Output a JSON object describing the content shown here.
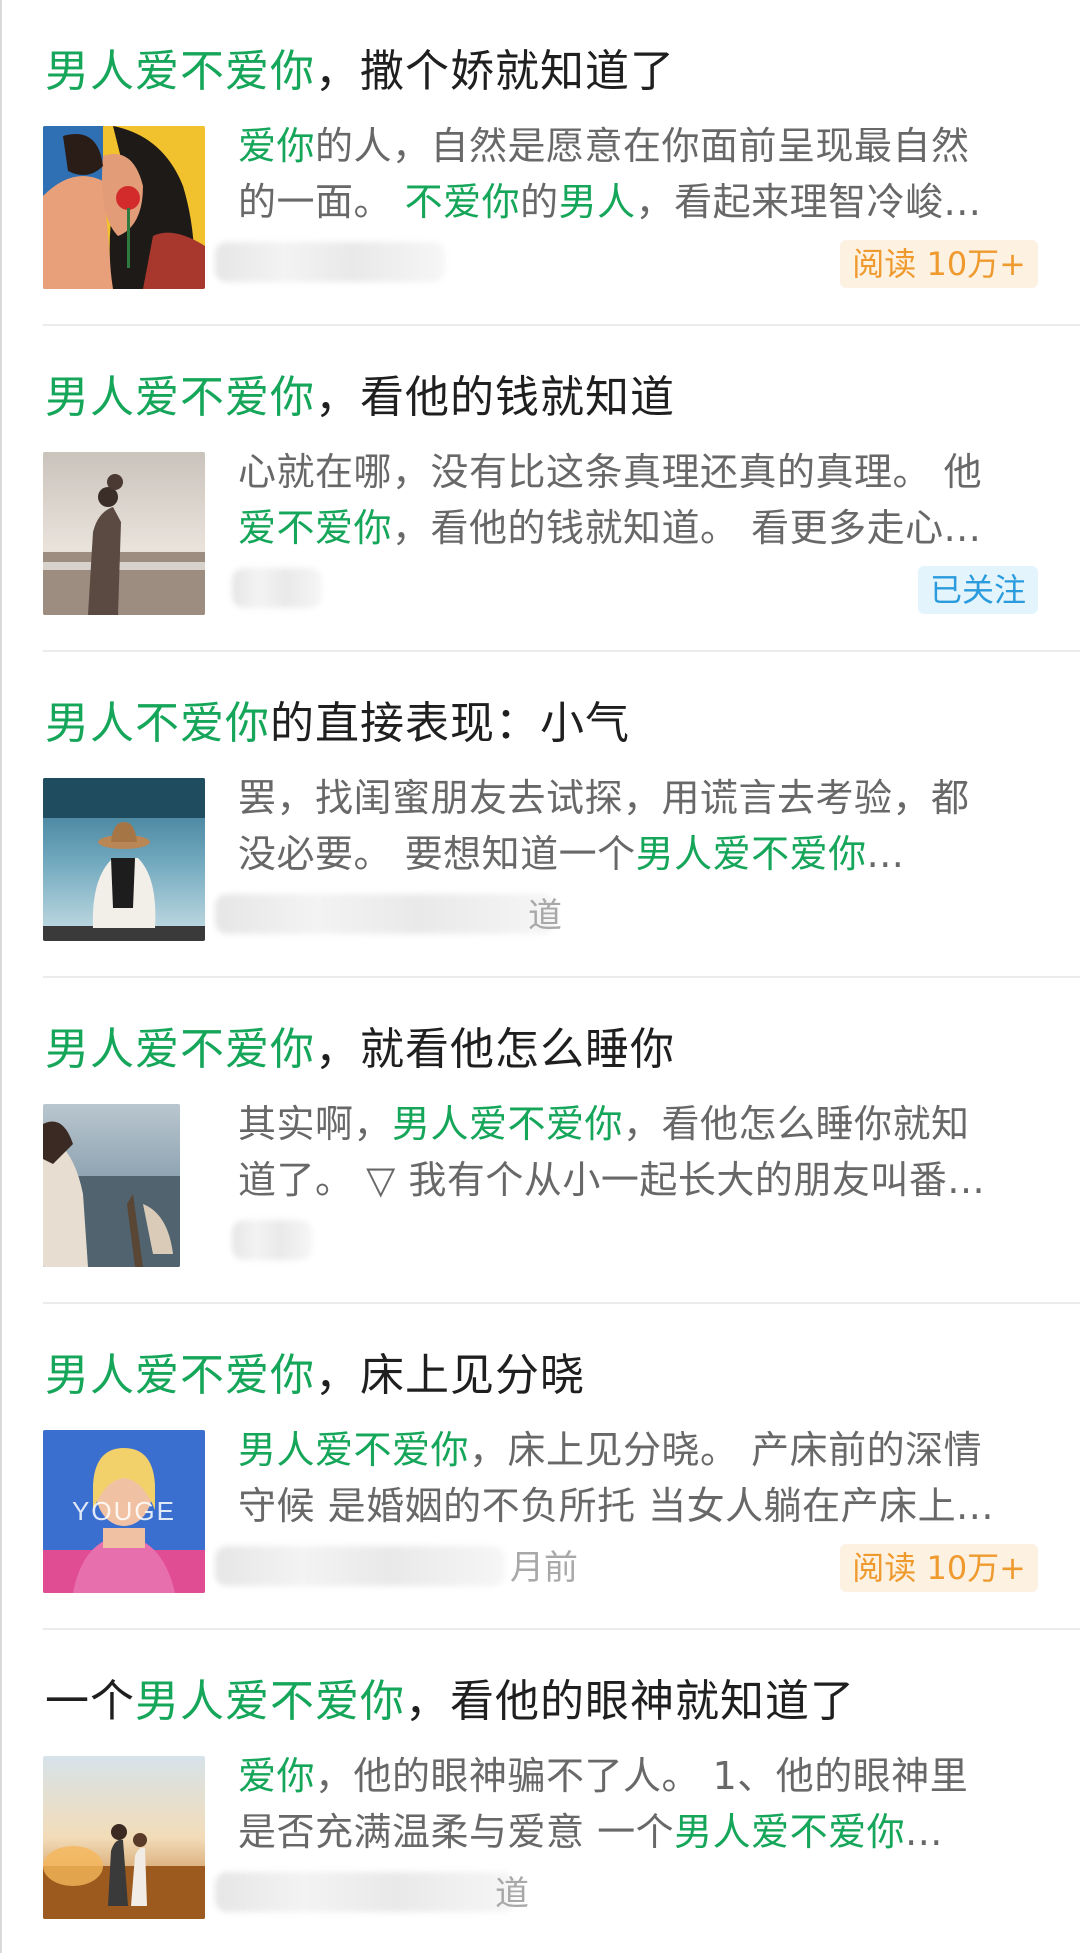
{
  "colors": {
    "highlight": "#15a65a",
    "snippet": "#686868",
    "read_badge": "#ef9a2f",
    "follow_badge": "#2a9bdc"
  },
  "articles": [
    {
      "title": [
        {
          "t": "男人爱不爱你",
          "h": true
        },
        {
          "t": "，撒个娇就知道了",
          "h": false
        }
      ],
      "snippet_lines": [
        [
          {
            "t": "爱你",
            "h": true
          },
          {
            "t": "的人，自然是愿意在你面前呈现最自然",
            "h": false
          }
        ],
        [
          {
            "t": "的一面。 ",
            "h": false
          },
          {
            "t": "不爱你",
            "h": true
          },
          {
            "t": "的",
            "h": false
          },
          {
            "t": "男人",
            "h": true
          },
          {
            "t": "，看起来理智冷峻...",
            "h": false
          }
        ]
      ],
      "thumbnail_icon": "couple-kiss-illustration",
      "badge": "阅读 10万+"
    },
    {
      "title": [
        {
          "t": "男人爱不爱你",
          "h": true
        },
        {
          "t": "，看他的钱就知道",
          "h": false
        }
      ],
      "snippet_lines": [
        [
          {
            "t": "心就在哪，没有比这条真理还真的真理。 他",
            "h": false
          }
        ],
        [
          {
            "t": "爱不爱你",
            "h": true
          },
          {
            "t": "，看他的钱就知道。 看更多走心...",
            "h": false
          }
        ]
      ],
      "thumbnail_icon": "beach-couple-photo",
      "badge": "已关注"
    },
    {
      "title": [
        {
          "t": "男人不爱你",
          "h": true
        },
        {
          "t": "的直接表现：小气",
          "h": false
        }
      ],
      "snippet_lines": [
        [
          {
            "t": "罢，找闺蜜朋友去试探，用谎言去考验，都",
            "h": false
          }
        ],
        [
          {
            "t": "没必要。 要想知道一个",
            "h": false
          },
          {
            "t": "男人爱不爱你",
            "h": true
          },
          {
            "t": "...",
            "h": false
          }
        ]
      ],
      "thumbnail_icon": "woman-hat-lake-photo",
      "meta_visible": "道"
    },
    {
      "title": [
        {
          "t": "男人爱不爱你",
          "h": true
        },
        {
          "t": "，就看他怎么睡你",
          "h": false
        }
      ],
      "snippet_lines": [
        [
          {
            "t": "其实啊，",
            "h": false
          },
          {
            "t": "男人爱不爱你",
            "h": true
          },
          {
            "t": "，看他怎么睡你就知",
            "h": false
          }
        ],
        [
          {
            "t": "道了。 ▽ 我有个从小一起长大的朋友叫番...",
            "h": false
          }
        ]
      ],
      "thumbnail_icon": "seaside-woman-photo"
    },
    {
      "title": [
        {
          "t": "男人爱不爱你",
          "h": true
        },
        {
          "t": "，床上见分晓",
          "h": false
        }
      ],
      "snippet_lines": [
        [
          {
            "t": "男人爱不爱你",
            "h": true
          },
          {
            "t": "，床上见分晓。 产床前的深情",
            "h": false
          }
        ],
        [
          {
            "t": "守候 是婚姻的不负所托 当女人躺在产床上...",
            "h": false
          }
        ]
      ],
      "thumbnail_icon": "magazine-cover-photo",
      "thumb_text": "YOUGE",
      "meta_visible": "月前",
      "badge": "阅读 10万+"
    },
    {
      "title": [
        {
          "t": "一个",
          "h": false
        },
        {
          "t": "男人爱不爱你",
          "h": true
        },
        {
          "t": "，看他的眼神就知道了",
          "h": false
        }
      ],
      "snippet_lines": [
        [
          {
            "t": "爱你",
            "h": true
          },
          {
            "t": "，他的眼神骗不了人。 1、他的眼神里",
            "h": false
          }
        ],
        [
          {
            "t": "是否充满温柔与爱意 一个",
            "h": false
          },
          {
            "t": "男人爱不爱你",
            "h": true
          },
          {
            "t": "...",
            "h": false
          }
        ]
      ],
      "thumbnail_icon": "sunset-couple-photo",
      "meta_visible": "道"
    }
  ]
}
